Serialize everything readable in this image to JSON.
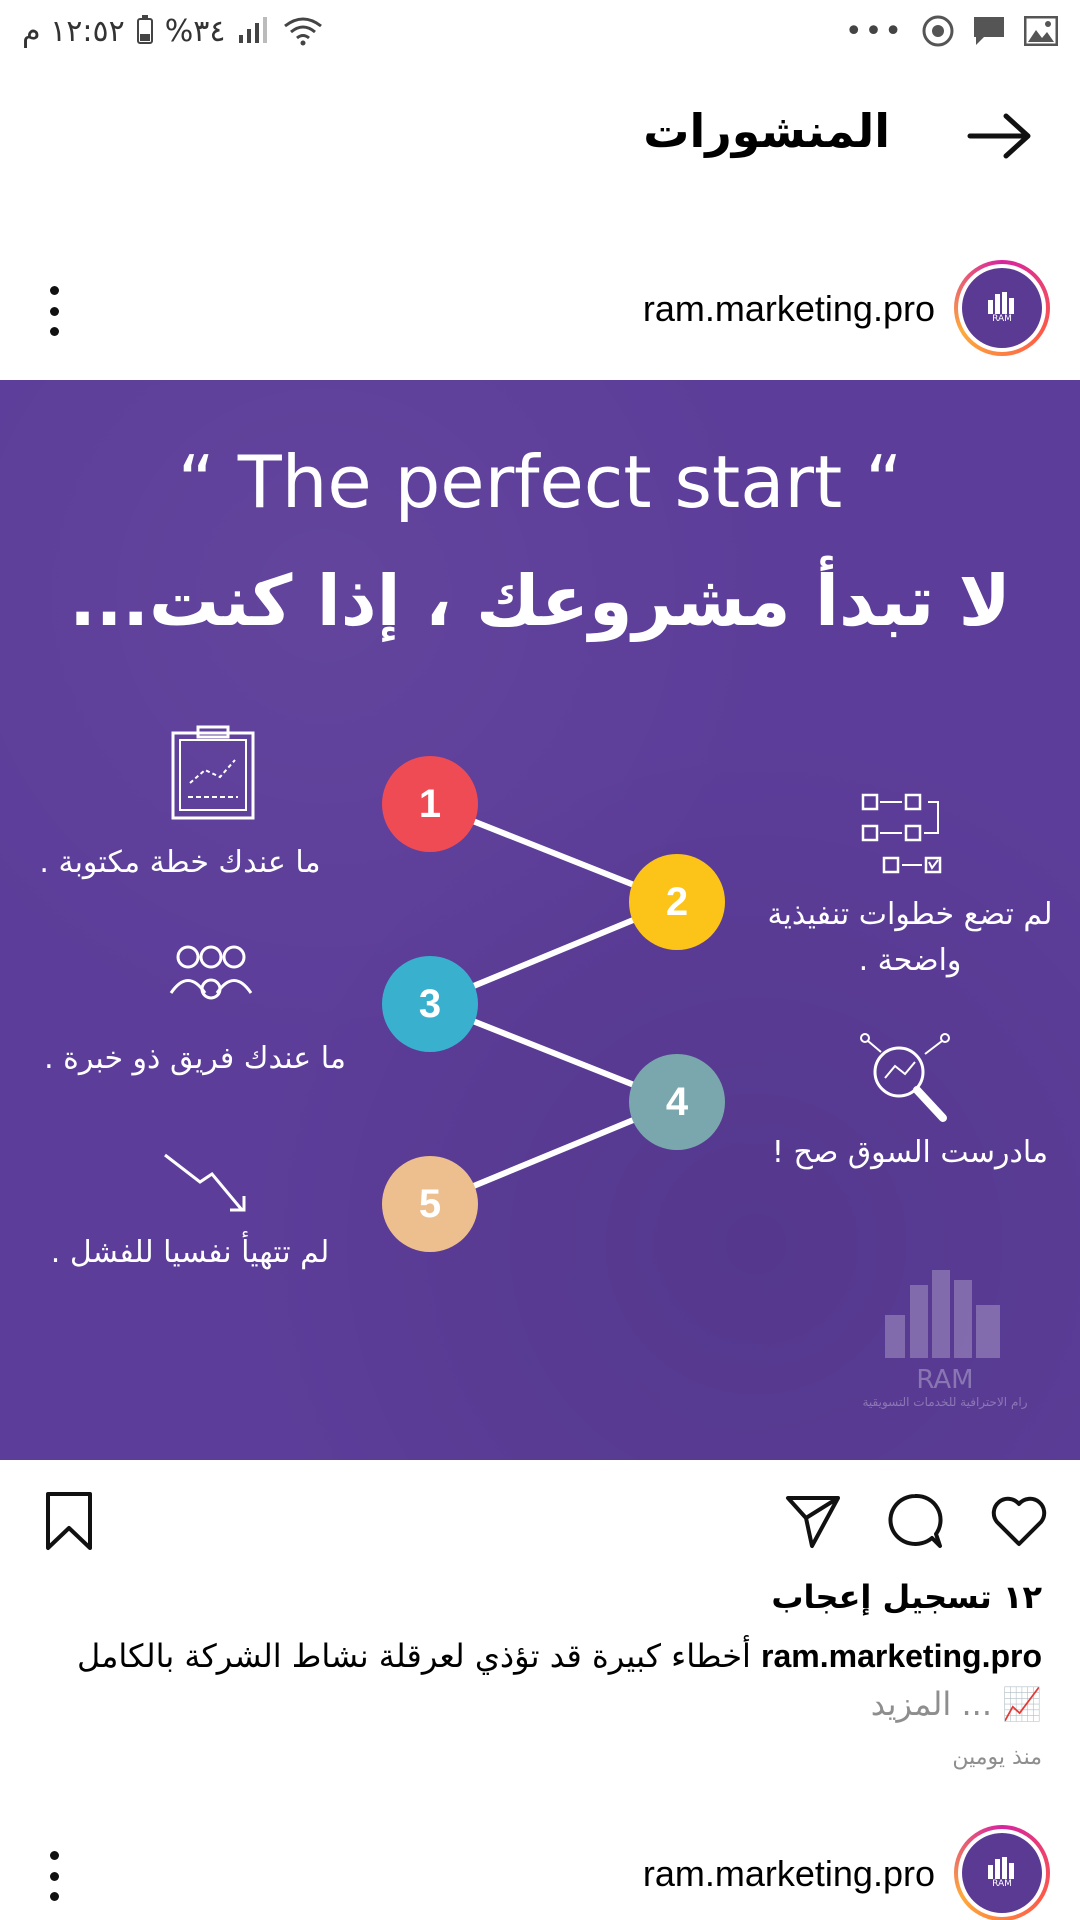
{
  "status_bar": {
    "time": "١٢:٥٢ م",
    "battery": "%٣٤",
    "battery_level": 0.34
  },
  "header": {
    "title": "المنشورات"
  },
  "post": {
    "username": "ram.marketing.pro",
    "avatar_text": "RAM",
    "image": {
      "en_title": "“ The perfect start “",
      "ar_title": "لا تبدأ مشروعك ، إذا كنت...",
      "steps": [
        {
          "num": "1",
          "label": "ما عندك خطة مكتوبة .",
          "color": "#ef4b55"
        },
        {
          "num": "2",
          "label": "لم تضع خطوات تنفيذية واضحة .",
          "color": "#fcc419"
        },
        {
          "num": "3",
          "label": "ما عندك فريق ذو خبرة .",
          "color": "#3ab0cf"
        },
        {
          "num": "4",
          "label": "مادرست السوق صح !",
          "color": "#7aa7ad"
        },
        {
          "num": "5",
          "label": "لم تتهيأ نفسيا للفشل .",
          "color": "#edbf8e"
        }
      ],
      "watermark_brand": "RAM",
      "watermark_sub": "رام الاحترافية للخدمات التسويقية"
    },
    "likes": "١٢ تسجيل إعجاب",
    "caption_user": "ram.marketing.pro",
    "caption_text": "أخطاء كبيرة قد تؤذي لعرقلة نشاط الشركة بالكامل",
    "caption_more": "📈 ... المزيد",
    "time": "منذ يومين"
  },
  "next_post": {
    "username": "ram.marketing.pro",
    "avatar_text": "RAM"
  }
}
